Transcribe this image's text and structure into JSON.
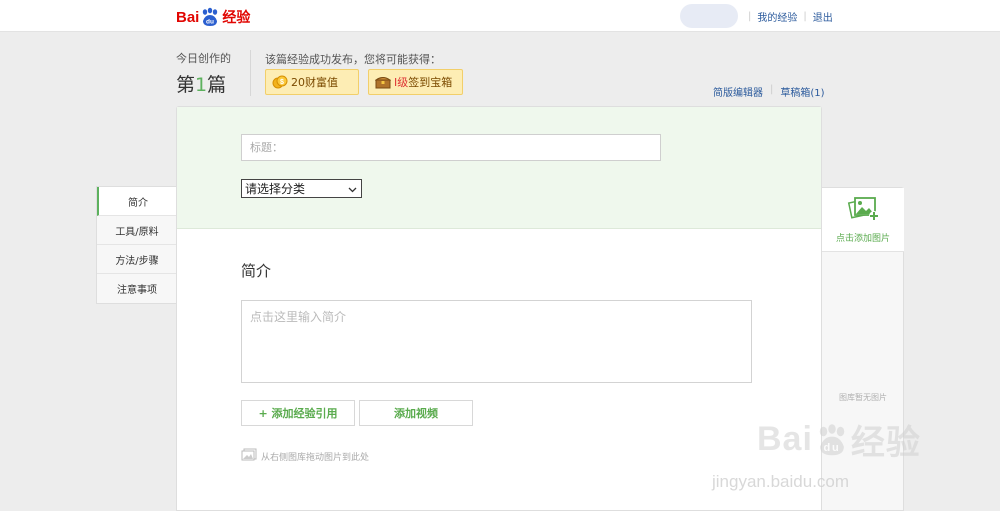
{
  "brand": {
    "logo_bai": "Bai",
    "logo_du": "du",
    "logo_jingyan": "经验"
  },
  "header": {
    "my_jingyan": "我的经验",
    "logout": "退出"
  },
  "today": {
    "label": "今日创作的",
    "prefix": "第",
    "count": "1",
    "suffix": "篇"
  },
  "rewards": {
    "label": "该篇经验成功发布，您将可能获得：",
    "wealth": "20财富值",
    "level_prefix": "I级",
    "level_text": "签到宝箱"
  },
  "editor_links": {
    "simple_editor": "简版编辑器",
    "drafts": "草稿箱(1)"
  },
  "form": {
    "title_placeholder": "标题：",
    "category_selected": "请选择分类",
    "intro_heading": "简介",
    "intro_placeholder": "点击这里输入简介",
    "add_quote": "+ 添加经验引用",
    "add_video": "添加视频",
    "drag_hint": "从右侧图库拖动图片到此处"
  },
  "nav": {
    "items": [
      {
        "label": "简介"
      },
      {
        "label": "工具/原料"
      },
      {
        "label": "方法/步骤"
      },
      {
        "label": "注意事项"
      }
    ]
  },
  "gallery": {
    "add_label": "点击添加图片",
    "empty": "图库暂无图片"
  },
  "watermark": {
    "big_bai": "Bai",
    "big_du": "du",
    "big_jy": "经验",
    "url": "jingyan.baidu.com"
  },
  "colors": {
    "brand_red": "#e10602",
    "accent_green": "#5db15e",
    "link_blue": "#2b5a9c"
  }
}
